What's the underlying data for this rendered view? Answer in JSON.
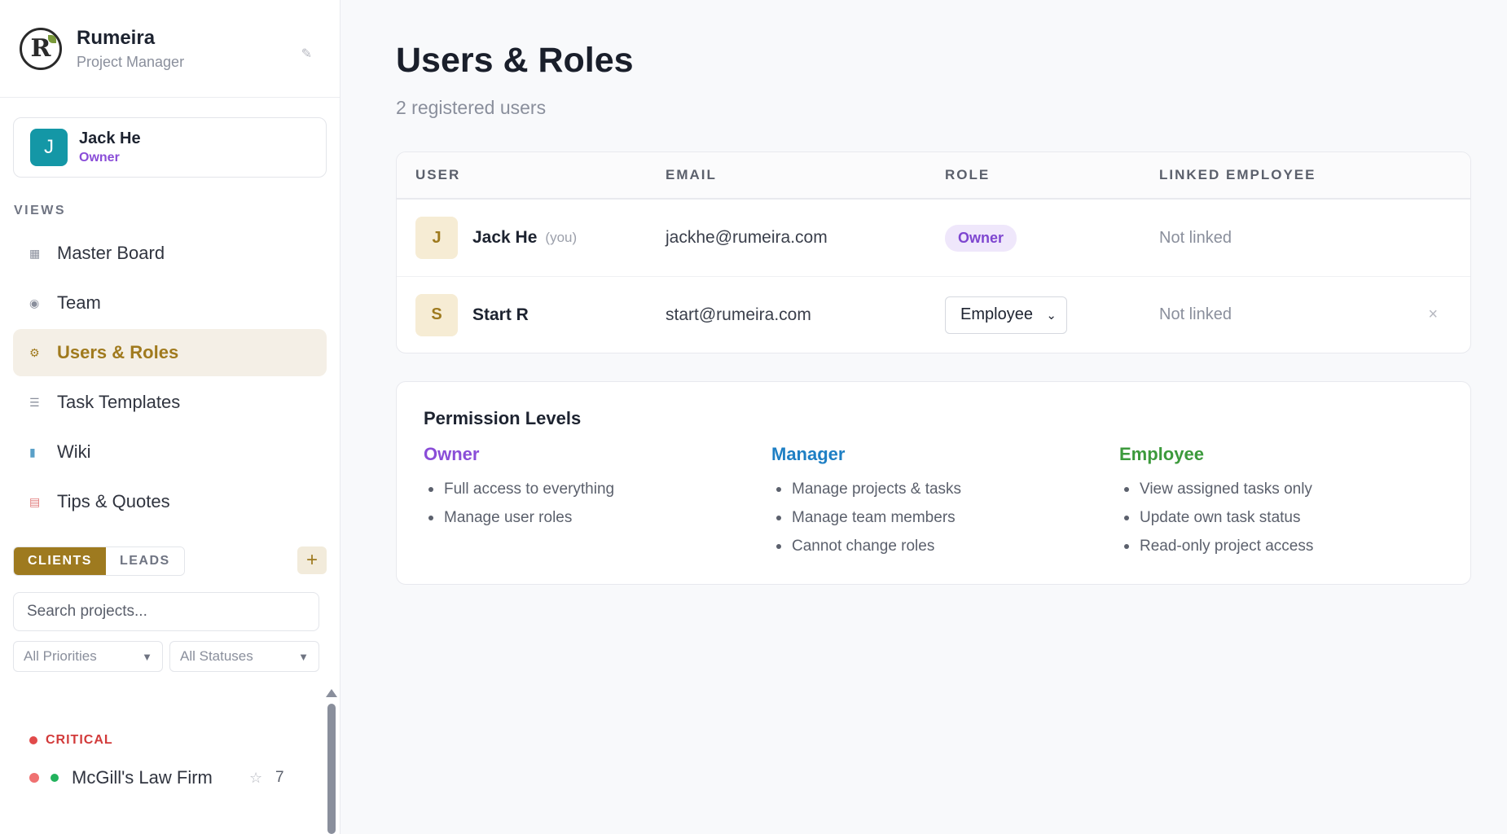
{
  "brand": {
    "name": "Rumeira",
    "subtitle": "Project Manager",
    "logo_letter": "R",
    "edit_icon": "pencil-icon"
  },
  "current_user": {
    "initial": "J",
    "name": "Jack He",
    "role": "Owner"
  },
  "views": {
    "label": "VIEWS",
    "items": [
      {
        "label": "Master Board",
        "icon": "grid-icon",
        "active": false
      },
      {
        "label": "Team",
        "icon": "team-icon",
        "active": false
      },
      {
        "label": "Users & Roles",
        "icon": "gear-icon",
        "active": true
      },
      {
        "label": "Task Templates",
        "icon": "list-icon",
        "active": false
      },
      {
        "label": "Wiki",
        "icon": "books-icon",
        "active": false
      },
      {
        "label": "Tips & Quotes",
        "icon": "notepad-icon",
        "active": false
      }
    ]
  },
  "project_tabs": {
    "clients": "CLIENTS",
    "leads": "LEADS",
    "active": "clients",
    "add_label": "+"
  },
  "search": {
    "placeholder": "Search projects..."
  },
  "filters": {
    "priority": "All Priorities",
    "status": "All Statuses"
  },
  "project_groups": [
    {
      "label": "CRITICAL",
      "projects": [
        {
          "name": "McGill's Law Firm",
          "count": "7"
        }
      ]
    }
  ],
  "page": {
    "title": "Users & Roles",
    "subtitle": "2 registered users"
  },
  "users_table": {
    "headers": [
      "USER",
      "EMAIL",
      "ROLE",
      "LINKED EMPLOYEE"
    ],
    "rows": [
      {
        "initial": "J",
        "name": "Jack He",
        "you": "(you)",
        "email": "jackhe@rumeira.com",
        "role": "Owner",
        "role_editable": false,
        "linked": "Not linked"
      },
      {
        "initial": "S",
        "name": "Start R",
        "you": "",
        "email": "start@rumeira.com",
        "role": "Employee",
        "role_editable": true,
        "linked": "Not linked",
        "remove_label": "×"
      }
    ]
  },
  "permissions": {
    "title": "Permission Levels",
    "levels": [
      {
        "name": "Owner",
        "color": "#8a4dd8",
        "items": [
          "Full access to everything",
          "Manage user roles"
        ]
      },
      {
        "name": "Manager",
        "color": "#1e7fc4",
        "items": [
          "Manage projects & tasks",
          "Manage team members",
          "Cannot change roles"
        ]
      },
      {
        "name": "Employee",
        "color": "#3c9a3c",
        "items": [
          "View assigned tasks only",
          "Update own task status",
          "Read-only project access"
        ]
      }
    ]
  },
  "colors": {
    "accent": "#9e7a1f",
    "owner": "#8a4dd8",
    "avatar": "#1497a6",
    "critical": "#d23a3a"
  }
}
